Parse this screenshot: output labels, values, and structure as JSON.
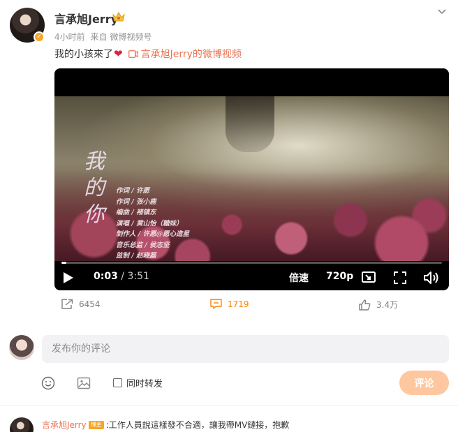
{
  "post": {
    "author": "言承旭Jerry",
    "time": "4小时前",
    "source_prefix": "来自",
    "source": "微博视频号",
    "text": "我的小孩來了",
    "heart_glyph": "❤",
    "video_link": "言承旭Jerry的微博视频"
  },
  "video": {
    "title_vertical": "我的你",
    "credits": [
      "作词 / 许愿",
      "作词 / 张小鹿",
      "编曲 / 褚镇东",
      "演唱 / 黄山怡（糖妹）",
      "制作人 / 许愿@愿心造星",
      "音乐总监 / 侯志坚",
      "监制 / 赵晓磊"
    ],
    "current_time": "0:03",
    "separator": " / ",
    "duration": "3:51",
    "progress_fraction": 0.013,
    "speed_label": "倍速",
    "quality_label": "720p"
  },
  "actions": {
    "reposts": "6454",
    "comments": "1719",
    "likes": "3.4万"
  },
  "composer": {
    "placeholder": "发布你的评论",
    "repost_label": "同时转发",
    "submit_label": "评论"
  },
  "reply": {
    "user": "言承旭Jerry",
    "badge": "博主",
    "text": ":工作人員說這樣發不合適，讓我帶MV鏈接，抱歉"
  },
  "colors": {
    "accent_orange": "#ff8200",
    "link_orange": "#eb7350",
    "submit_disabled": "#ffc79f",
    "verified_gold": "#f5a623",
    "heart_red": "#e0213b"
  }
}
